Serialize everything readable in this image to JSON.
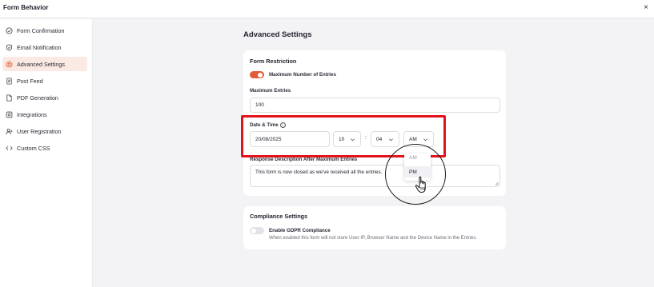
{
  "window": {
    "title": "Form Behavior",
    "close_glyph": "×"
  },
  "sidebar": {
    "items": [
      {
        "label": "Form Confirmation",
        "icon": "check-circle-icon",
        "active": false
      },
      {
        "label": "Email Notification",
        "icon": "shield-check-icon",
        "active": false
      },
      {
        "label": "Advanced Settings",
        "icon": "gear-icon",
        "active": true
      },
      {
        "label": "Post Feed",
        "icon": "document-icon",
        "active": false
      },
      {
        "label": "PDF Generation",
        "icon": "file-icon",
        "active": false
      },
      {
        "label": "Integrations",
        "icon": "integrations-icon",
        "active": false
      },
      {
        "label": "User Registration",
        "icon": "user-plus-icon",
        "active": false
      },
      {
        "label": "Custom CSS",
        "icon": "code-icon",
        "active": false
      }
    ]
  },
  "main": {
    "title": "Advanced Settings"
  },
  "restriction": {
    "title": "Form Restriction",
    "max_toggle_label": "Maximum Number of Entries",
    "max_toggle_on": true,
    "max_entries_label": "Maximum Entries",
    "max_entries_value": "100",
    "date_time_label": "Date & Time",
    "date_value": "20/08/2025",
    "hour_value": "10",
    "minute_value": "04",
    "colon": ":",
    "ampm_value": "AM",
    "ampm_options": [
      "AM",
      "PM"
    ],
    "response_label": "Response Description After Maximum Entries",
    "response_value": "This form is now closed as we've received all the entries."
  },
  "compliance": {
    "title": "Compliance Settings",
    "gdpr_label": "Enable GDPR Compliance",
    "gdpr_on": false,
    "gdpr_help": "When enabled this form will not store User IP, Browser Name and the Device Name in the Entries."
  },
  "colors": {
    "accent": "#e25b36",
    "active_bg": "#fbe9e3",
    "highlight": "#e2141b",
    "page_bg": "#f3f3f5"
  }
}
